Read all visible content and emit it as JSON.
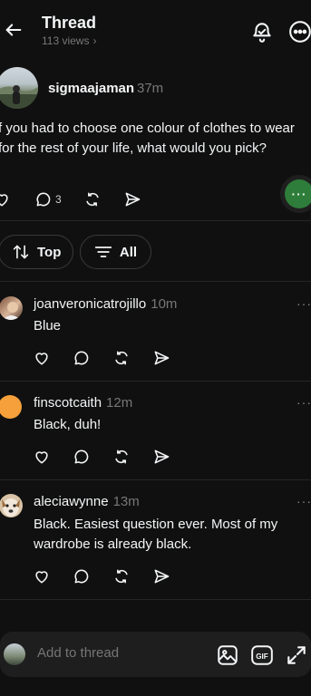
{
  "header": {
    "title": "Thread",
    "views": "113 views",
    "views_chevron": "›"
  },
  "post": {
    "author": "sigmaajaman",
    "time": "37m",
    "text": "f you had to choose one colour of clothes to wear for the rest of your life, what would you pick?",
    "reply_count": "3"
  },
  "fab": {
    "label": "···"
  },
  "sort": {
    "top_label": "Top",
    "all_label": "All"
  },
  "comments": [
    {
      "author": "joanveronicatrojillo",
      "time": "10m",
      "text": "Blue",
      "more": "···"
    },
    {
      "author": "finscotcaith",
      "time": "12m",
      "text": "Black, duh!",
      "more": "···"
    },
    {
      "author": "aleciawynne",
      "time": "13m",
      "text": "Black. Easiest question ever. Most of my wardrobe is already black.",
      "more": "···"
    }
  ],
  "composer": {
    "placeholder": "Add to thread"
  },
  "icons": {
    "back": "arrow-left-icon",
    "bell": "bell-icon",
    "more": "more-circle-icon",
    "like": "heart-icon",
    "reply": "comment-icon",
    "repost": "repost-icon",
    "share": "send-icon",
    "sort": "sort-arrows-icon",
    "filter": "filter-lines-icon",
    "image": "image-icon",
    "gif": "gif-icon",
    "expand": "expand-icon"
  },
  "colors": {
    "background": "#101010",
    "text": "#f3f5f7",
    "muted": "#777777",
    "divider": "#262626",
    "fab_accent": "#2e7d3a",
    "avatar_orange": "#f5a03a"
  }
}
